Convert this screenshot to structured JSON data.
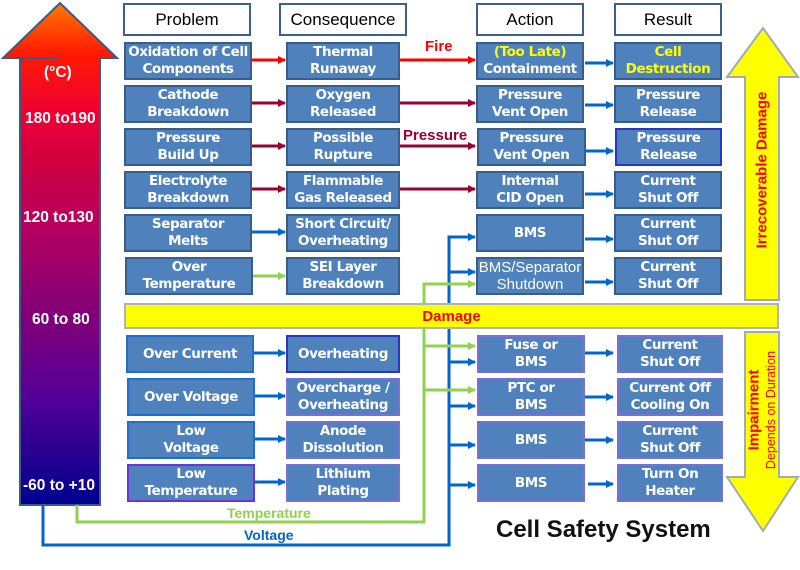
{
  "title": "Cell Safety System",
  "headers": {
    "problem": "Problem",
    "consequence": "Consequence",
    "action": "Action",
    "result": "Result"
  },
  "temperature_scale": {
    "unit": "(°C)",
    "labels": [
      "180 to190",
      "120 to130",
      "60 to 80",
      "-60 to +10"
    ]
  },
  "rows": [
    {
      "problem": "Oxidation of Cell\nComponents",
      "consequence": "Thermal\nRunaway",
      "action_prefix": "(Too Late)",
      "action": "Containment",
      "result": "Cell\nDestruction",
      "arrow1_color": "#ff0000",
      "arrow2_color": "#ff0000",
      "arrow2_label": "Fire"
    },
    {
      "problem": "Cathode\nBreakdown",
      "consequence": "Oxygen\nReleased",
      "action": "Pressure\nVent Open",
      "result": "Pressure\nRelease",
      "arrow1_color": "#990033",
      "arrow2_color": "#990033"
    },
    {
      "problem": "Pressure\nBuild Up",
      "consequence": "Possible\nRupture",
      "action": "Pressure\nVent Open",
      "result": "Pressure\nRelease",
      "arrow1_color": "#990033",
      "arrow2_color": "#990033",
      "arrow2_label": "Pressure"
    },
    {
      "problem": "Electrolyte\nBreakdown",
      "consequence": "Flammable\nGas Released",
      "action": "Internal\nCID Open",
      "result": "Current\nShut Off",
      "arrow1_color": "#990033",
      "arrow2_color": "#990033"
    },
    {
      "problem": "Separator\nMelts",
      "consequence": "Short Circuit/\nOverheating",
      "action": "BMS",
      "result": "Current\nShut Off",
      "arrow1_color": "#0066cc"
    },
    {
      "problem": "Over\nTemperature",
      "consequence": "SEI  Layer\nBreakdown",
      "action": "BMS/Separator\nShutdown",
      "result": "Current\nShut Off",
      "arrow1_color": "#92d050"
    },
    {
      "problem": "Over Current",
      "consequence": "Overheating",
      "action": "Fuse or\nBMS",
      "result": "Current\nShut Off",
      "arrow1_color": "#0066cc"
    },
    {
      "problem": "Over Voltage",
      "consequence": "Overcharge /\nOverheating",
      "action": "PTC or\nBMS",
      "result": "Current Off\nCooling On",
      "arrow1_color": "#0066cc"
    },
    {
      "problem": "Low\nVoltage",
      "consequence": "Anode\nDissolution",
      "action": "BMS",
      "result": "Current\nShut Off",
      "arrow1_color": "#0066cc"
    },
    {
      "problem": "Low\nTemperature",
      "consequence": "Lithium Plating",
      "action": "BMS",
      "result": "Turn On\nHeater",
      "arrow1_color": "#0066cc"
    }
  ],
  "damage_label": "Damage",
  "irrecoverable_label": "Irrecoverable Damage",
  "impairment_label": "Impairment",
  "impairment_sub": "Depends on Duration",
  "flow_labels": {
    "temperature": "Temperature",
    "voltage": "Voltage"
  },
  "colors": {
    "box_fill": "#4f81bd",
    "box_border": "#385d8a",
    "temperature_line": "#92d050",
    "voltage_line": "#0066cc",
    "fire": "#ff0000",
    "pressure": "#990033",
    "damage_fill": "#ffff00",
    "damage_text": "#ff0000"
  }
}
